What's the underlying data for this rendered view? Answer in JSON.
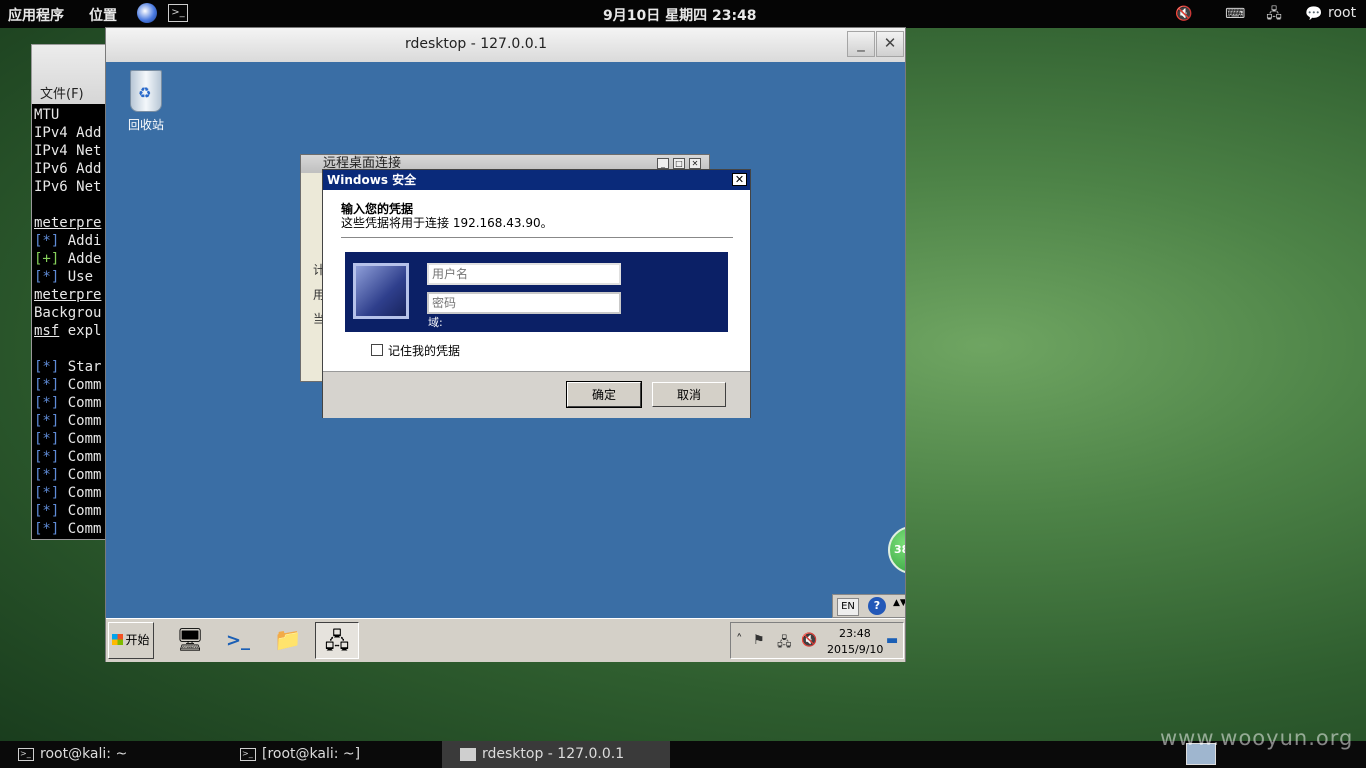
{
  "gnome_top_panel": {
    "applications": "应用程序",
    "places": "位置",
    "clock": "9月10日 星期四 23:48",
    "user": "root"
  },
  "terminal": {
    "menu_file": "文件(F)",
    "lines": [
      {
        "prefix": "",
        "text": "MTU",
        "style": ""
      },
      {
        "prefix": "",
        "text": "IPv4 Add",
        "style": ""
      },
      {
        "prefix": "",
        "text": "IPv4 Net",
        "style": ""
      },
      {
        "prefix": "",
        "text": "IPv6 Add",
        "style": ""
      },
      {
        "prefix": "",
        "text": "IPv6 Net",
        "style": ""
      },
      {
        "prefix": "",
        "text": "",
        "style": ""
      },
      {
        "prefix": "",
        "text": "meterpre",
        "style": "ul"
      },
      {
        "prefix": "[*]",
        "text": " Addi",
        "style": "blue"
      },
      {
        "prefix": "[+]",
        "text": " Adde",
        "style": "green"
      },
      {
        "prefix": "[*]",
        "text": " Use",
        "style": "blue"
      },
      {
        "prefix": "",
        "text": "meterpre",
        "style": "ul"
      },
      {
        "prefix": "",
        "text": "Backgrou",
        "style": ""
      },
      {
        "prefix": "msf",
        "text": " expl",
        "style": "ulprefix"
      },
      {
        "prefix": "",
        "text": "",
        "style": ""
      },
      {
        "prefix": "[*]",
        "text": " Star",
        "style": "blue"
      },
      {
        "prefix": "[*]",
        "text": " Comm",
        "style": "blue"
      },
      {
        "prefix": "[*]",
        "text": " Comm",
        "style": "blue"
      },
      {
        "prefix": "[*]",
        "text": " Comm",
        "style": "blue"
      },
      {
        "prefix": "[*]",
        "text": " Comm",
        "style": "blue"
      },
      {
        "prefix": "[*]",
        "text": " Comm",
        "style": "blue"
      },
      {
        "prefix": "[*]",
        "text": " Comm",
        "style": "blue"
      },
      {
        "prefix": "[*]",
        "text": " Comm",
        "style": "blue"
      },
      {
        "prefix": "[*]",
        "text": " Comm",
        "style": "blue"
      },
      {
        "prefix": "[*]",
        "text": " Comm",
        "style": "blue"
      }
    ]
  },
  "rdesktop": {
    "title": "rdesktop - 127.0.0.1",
    "minimize": "_",
    "close": "✕"
  },
  "win_desktop": {
    "recycle_bin": "回收站"
  },
  "rdc_window": {
    "title": "远程桌面连接",
    "line1": "计",
    "line2": "用",
    "line3": "当"
  },
  "security_dialog": {
    "title": "Windows 安全",
    "heading": "输入您的凭据",
    "subtext": "这些凭据将用于连接 192.168.43.90。",
    "username_placeholder": "用户名",
    "password_placeholder": "密码",
    "domain_label": "域:",
    "remember": "记住我的凭据",
    "ok": "确定",
    "cancel": "取消"
  },
  "badge_text": "38",
  "langbar": {
    "lang": "EN",
    "help": "?",
    "more": "▲▼"
  },
  "win_taskbar": {
    "start": "开始",
    "clock_time": "23:48",
    "clock_date": "2015/9/10"
  },
  "gnome_bottom_bar": {
    "tasks": [
      "root@kali: ~",
      "[root@kali: ~]",
      "rdesktop - 127.0.0.1"
    ]
  },
  "watermark": "www.wooyun.org"
}
